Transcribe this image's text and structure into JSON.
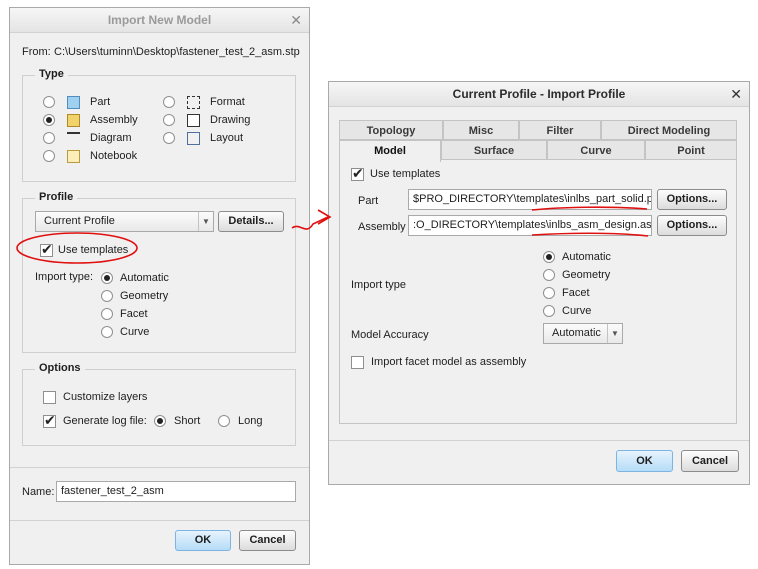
{
  "import_dialog": {
    "title": "Import New Model",
    "from_label": "From:",
    "from_path": "C:\\Users\\tuminn\\Desktop\\fastener_test_2_asm.stp",
    "type_group": {
      "title": "Type",
      "options": [
        "Part",
        "Assembly",
        "Diagram",
        "Notebook",
        "Format",
        "Drawing",
        "Layout"
      ],
      "selected": "Assembly"
    },
    "profile_group": {
      "title": "Profile",
      "profile_value": "Current Profile",
      "details_label": "Details...",
      "use_templates_label": "Use templates",
      "import_type_label": "Import type:",
      "import_types": [
        "Automatic",
        "Geometry",
        "Facet",
        "Curve"
      ],
      "selected": "Automatic"
    },
    "options_group": {
      "title": "Options",
      "customize_layers_label": "Customize layers",
      "generate_log_label": "Generate log file:",
      "short_label": "Short",
      "long_label": "Long"
    },
    "name_label": "Name:",
    "name_value": "fastener_test_2_asm",
    "ok_label": "OK",
    "cancel_label": "Cancel"
  },
  "profile_dialog": {
    "title": "Current Profile - Import Profile",
    "tabs_row1": [
      "Topology",
      "Misc",
      "Filter",
      "Direct Modeling"
    ],
    "tabs_row2": [
      "Model",
      "Surface",
      "Curve",
      "Point"
    ],
    "active_tab": "Model",
    "use_templates_label": "Use templates",
    "part_label": "Part",
    "part_value": "$PRO_DIRECTORY\\templates\\inlbs_part_solid.prt",
    "assembly_label": "Assembly",
    "assembly_value": ":O_DIRECTORY\\templates\\inlbs_asm_design.asm",
    "options_label": "Options...",
    "import_type_label": "Import type",
    "import_types": [
      "Automatic",
      "Geometry",
      "Facet",
      "Curve"
    ],
    "selected": "Automatic",
    "model_accuracy_label": "Model Accuracy",
    "model_accuracy_value": "Automatic",
    "facet_label": "Import facet model as assembly",
    "ok_label": "OK",
    "cancel_label": "Cancel"
  },
  "colors": {
    "annotation_red": "#e01010",
    "ok_blue": "#b5dcf7"
  }
}
